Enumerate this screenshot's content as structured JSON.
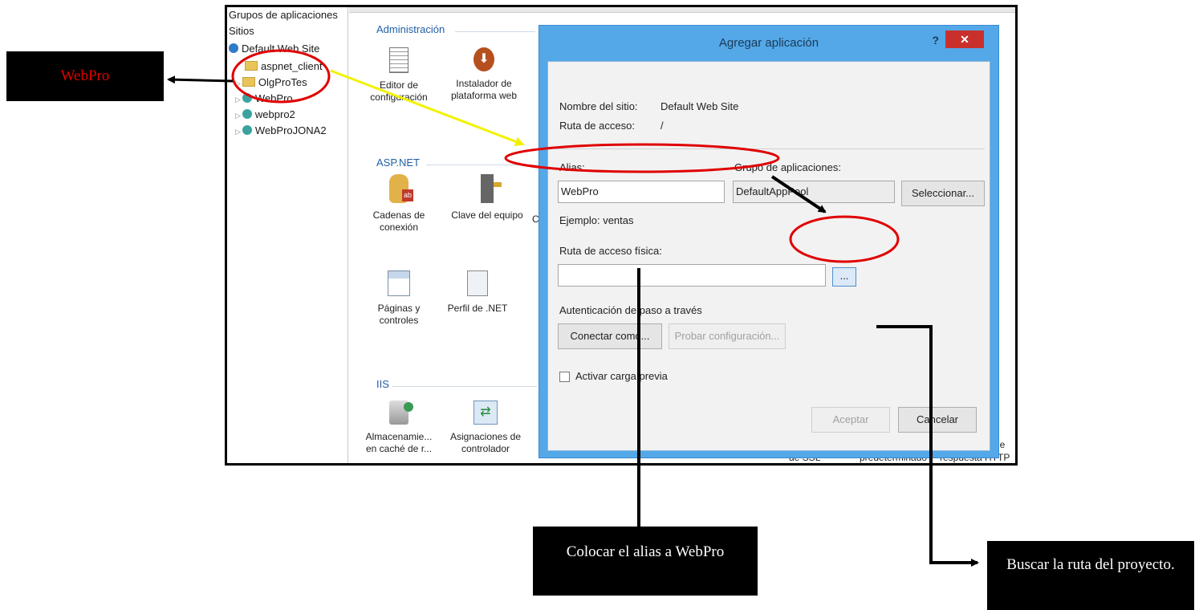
{
  "tree": {
    "items": [
      {
        "label": "Grupos de aplicaciones",
        "icon": "none"
      },
      {
        "label": "Sitios",
        "icon": "none"
      },
      {
        "label": "Default Web Site",
        "icon": "globe-icon"
      },
      {
        "label": "aspnet_client",
        "icon": "folder-icon"
      },
      {
        "label": "OlgProTes",
        "icon": "folder-icon"
      },
      {
        "label": "WebPro",
        "icon": "web-app-icon"
      },
      {
        "label": "webpro2",
        "icon": "web-app-icon"
      },
      {
        "label": "WebProJONA2",
        "icon": "web-app-icon"
      }
    ]
  },
  "sections": {
    "administracion": "Administración",
    "aspnet": "ASP.NET",
    "iis": "IIS"
  },
  "features": {
    "editor": "Editor de configuración",
    "instalador": "Instalador de plataforma web",
    "cadenas": "Cadenas de conexión",
    "clave": "Clave del equipo",
    "clave_next": "C",
    "paginas": "Páginas y controles",
    "perfil": "Perfil de .NET",
    "almacenamiento": "Almacenamie... en caché de r...",
    "asignaciones": "Asignaciones de controlador",
    "ssl": "de SSL",
    "predeterminado": "predeterminado",
    "respuesta_de": "de",
    "respuesta": "respuesta HTTP"
  },
  "dialog": {
    "title": "Agregar aplicación",
    "help": "?",
    "close": "✕",
    "site_name_label": "Nombre del sitio:",
    "site_name_value": "Default Web Site",
    "path_label": "Ruta de acceso:",
    "path_value": "/",
    "alias_label": "Alias:",
    "alias_value": "WebPro",
    "app_pool_label": "Grupo de aplicaciones:",
    "app_pool_value": "DefaultAppPool",
    "select_button": "Seleccionar...",
    "example": "Ejemplo: ventas",
    "physical_path_label": "Ruta de acceso física:",
    "physical_path_value": "",
    "browse_button": "...",
    "passthrough_label": "Autenticación de paso a través",
    "connect_as_button": "Conectar como...",
    "test_settings_button": "Probar configuración...",
    "preload_label": "Activar carga previa",
    "ok_button": "Aceptar",
    "cancel_button": "Cancelar"
  },
  "callouts": {
    "webpro": "WebPro",
    "alias": "Colocar el alias a WebPro",
    "buscar": "Buscar la ruta del proyecto."
  },
  "colors": {
    "callout_bg": "#000000",
    "webpro_text": "#e00000",
    "highlight_ellipse": "#e00000",
    "yellow_arrow": "#f2f200",
    "dialog_frame": "#54a8e8",
    "close_button": "#c9302c"
  }
}
